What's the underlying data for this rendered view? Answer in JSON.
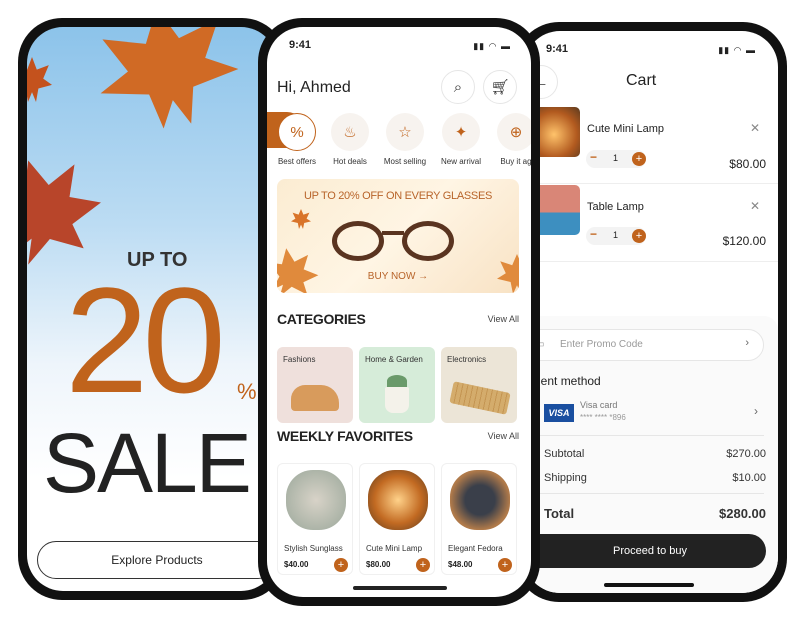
{
  "promo_screen": {
    "headline_top": "UP TO",
    "big_number": "20",
    "percent": "%",
    "word": "SALE",
    "cta": "Explore Products"
  },
  "home_screen": {
    "time": "9:41",
    "greeting": "Hi, Ahmed",
    "icons": [
      "search-icon",
      "cart-icon"
    ],
    "quick_categories": [
      {
        "label": "Best offers",
        "icon": "%"
      },
      {
        "label": "Hot deals",
        "icon": "🔥"
      },
      {
        "label": "Most selling",
        "icon": "☆"
      },
      {
        "label": "New arrival",
        "icon": "✦"
      },
      {
        "label": "Buy it ag",
        "icon": "⊕"
      }
    ],
    "banner": {
      "title": "UP TO 20% OFF ON EVERY GLASSES",
      "cta": "BUY NOW →"
    },
    "categories": {
      "title": "CATEGORIES",
      "view_all": "View All",
      "items": [
        {
          "label": "Fashions",
          "color": "#efe0dc"
        },
        {
          "label": "Home & Garden",
          "color": "#d6ecd9"
        },
        {
          "label": "Electronics",
          "color": "#ece5d7"
        }
      ]
    },
    "weekly": {
      "title": "WEEKLY FAVORITES",
      "view_all": "View All",
      "items": [
        {
          "name": "Stylish Sunglass",
          "price": "$40.00"
        },
        {
          "name": "Cute Mini Lamp",
          "price": "$80.00"
        },
        {
          "name": "Elegant Fedora",
          "price": "$48.00"
        }
      ]
    }
  },
  "cart_screen": {
    "time": "9:41",
    "title": "Cart",
    "items": [
      {
        "name": "Cute Mini Lamp",
        "qty": "1",
        "price": "$80.00"
      },
      {
        "name": "Table Lamp",
        "qty": "1",
        "price": "$120.00"
      }
    ],
    "promo_placeholder": "Enter Promo Code",
    "payment_title": "Payment method",
    "card_brand": "VISA",
    "card_name": "Visa card",
    "card_number": "**** **** *896",
    "subtotal_label": "Subtotal",
    "subtotal": "$270.00",
    "shipping_label": "Shipping",
    "shipping": "$10.00",
    "total_label": "Total",
    "total": "$280.00",
    "cta": "Proceed to buy"
  },
  "colors": {
    "accent": "#c0631c",
    "dark": "#222222"
  }
}
